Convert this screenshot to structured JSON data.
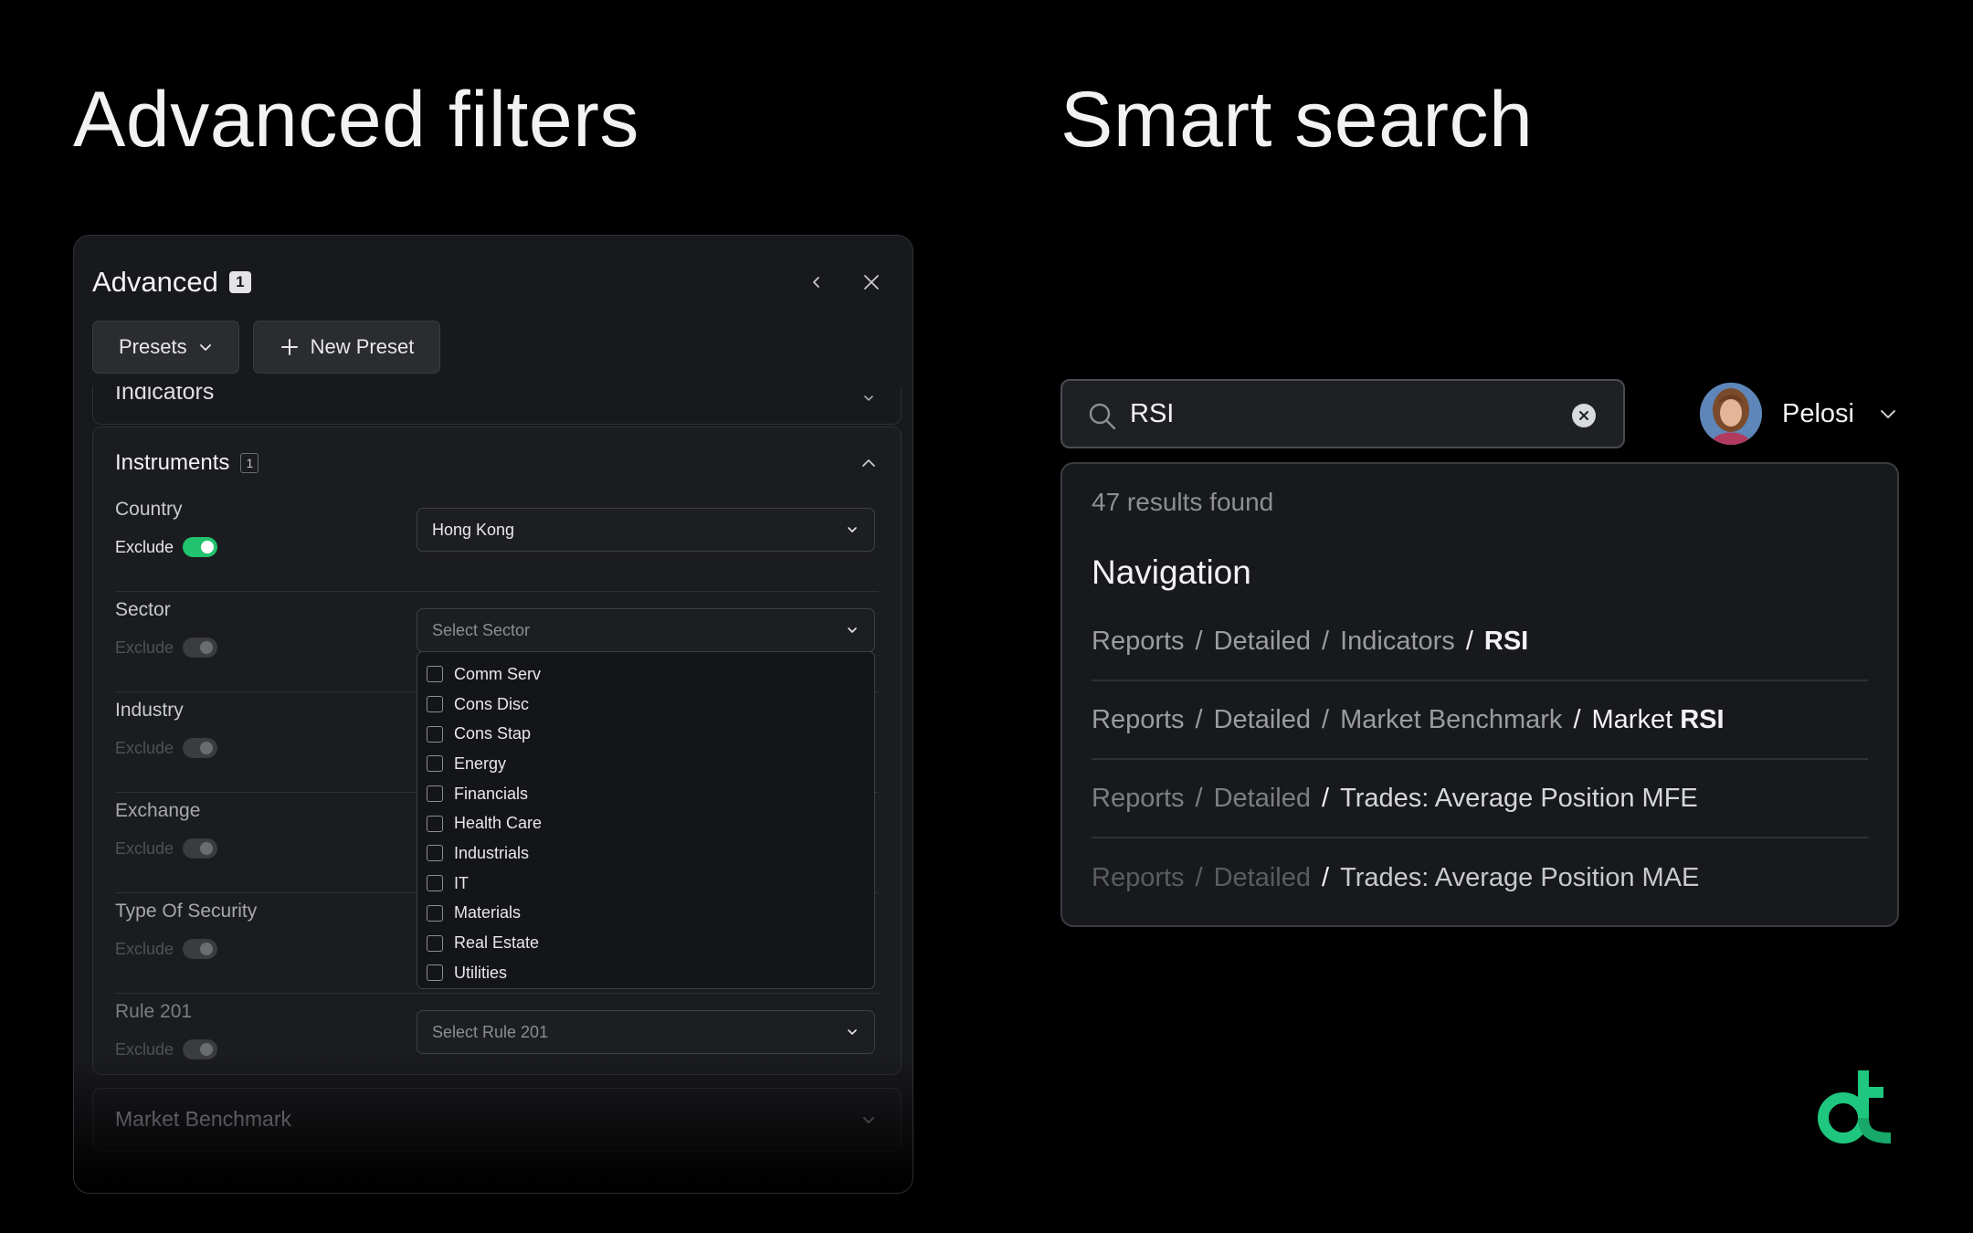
{
  "headings": {
    "left": "Advanced filters",
    "right": "Smart search"
  },
  "panel": {
    "title": "Advanced",
    "count": "1",
    "toolbar": {
      "presets_label": "Presets",
      "new_preset_label": "New Preset"
    },
    "indicators_label": "Indicators",
    "instruments": {
      "title": "Instruments",
      "count": "1",
      "exclude_label": "Exclude",
      "rows": {
        "country": {
          "label": "Country",
          "value": "Hong Kong",
          "exclude_on": true
        },
        "sector": {
          "label": "Sector",
          "placeholder": "Select Sector",
          "exclude_on": false
        },
        "industry": {
          "label": "Industry",
          "exclude_on": false
        },
        "exchange": {
          "label": "Exchange",
          "exclude_on": false
        },
        "type_of_security": {
          "label": "Type Of Security",
          "exclude_on": false
        },
        "rule201": {
          "label": "Rule 201",
          "placeholder": "Select Rule 201",
          "exclude_on": false
        }
      },
      "sector_options": [
        "Comm Serv",
        "Cons Disc",
        "Cons Stap",
        "Energy",
        "Financials",
        "Health Care",
        "Industrials",
        "IT",
        "Materials",
        "Real Estate",
        "Utilities"
      ]
    },
    "market_benchmark_label": "Market Benchmark"
  },
  "search": {
    "value": "RSI",
    "user_name": "Pelosi",
    "results_count": "47 results found",
    "section_title": "Navigation",
    "sep": "/",
    "results": [
      {
        "crumbs": [
          "Reports",
          "Detailed",
          "Indicators"
        ],
        "final_prefix": "",
        "final_bold": "RSI"
      },
      {
        "crumbs": [
          "Reports",
          "Detailed",
          "Market Benchmark"
        ],
        "final_prefix": "Market ",
        "final_bold": "RSI"
      },
      {
        "crumbs": [
          "Reports",
          "Detailed"
        ],
        "final_prefix": "Trades: Average Position MFE",
        "final_bold": ""
      },
      {
        "crumbs": [
          "Reports",
          "Detailed"
        ],
        "final_prefix": "Trades: Average Position MAE",
        "final_bold": ""
      }
    ]
  },
  "colors": {
    "background": "#000000",
    "panel": "#18191c",
    "toggle_on": "#22c36e",
    "brand": "#1fc77e"
  },
  "icons": {
    "back": "chevron-left-icon",
    "close": "close-icon",
    "presets": "chevron-down-icon",
    "new_preset": "plus-icon",
    "search": "search-icon",
    "clear": "clear-icon",
    "logo": "brand-logo-icon"
  }
}
